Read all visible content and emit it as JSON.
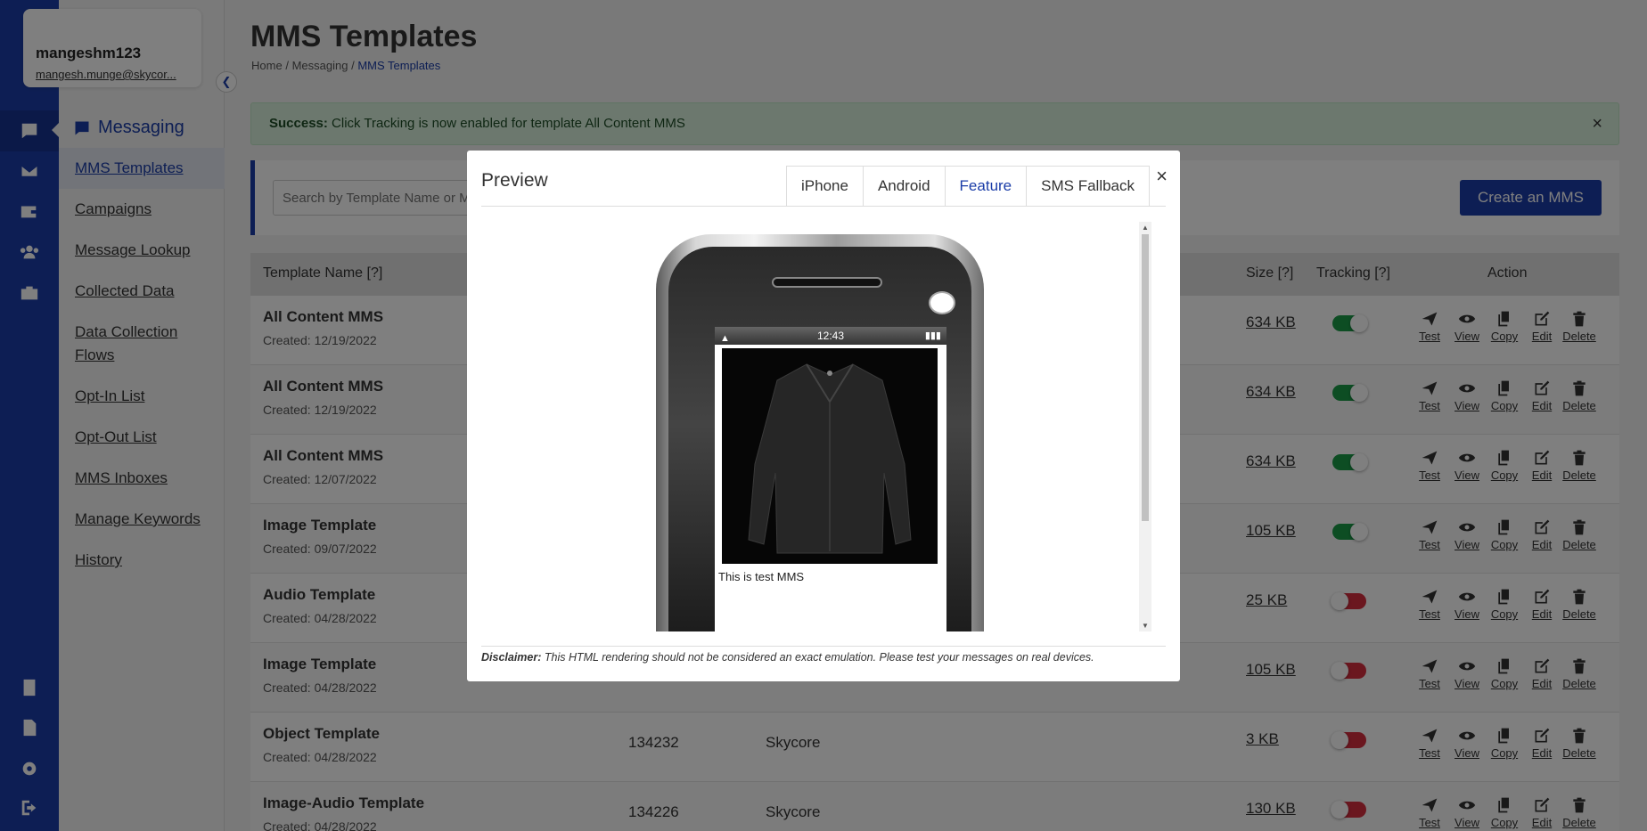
{
  "user": {
    "name": "mangeshm123",
    "email": "mangesh.munge@skycor..."
  },
  "sidebar": {
    "section": "Messaging",
    "items": [
      {
        "label": "MMS Templates"
      },
      {
        "label": "Campaigns"
      },
      {
        "label": "Message Lookup"
      },
      {
        "label": "Collected Data"
      },
      {
        "label": "Data Collection Flows"
      },
      {
        "label": "Opt-In List"
      },
      {
        "label": "Opt-Out List"
      },
      {
        "label": "MMS Inboxes"
      },
      {
        "label": "Manage Keywords"
      },
      {
        "label": "History"
      }
    ]
  },
  "page": {
    "title": "MMS Templates",
    "breadcrumb": {
      "home": "Home",
      "sep1": "/",
      "messaging": "Messaging",
      "sep2": "/",
      "current": "MMS Templates"
    }
  },
  "alert": {
    "strong": "Success:",
    "text": " Click Tracking is now enabled for template All Content MMS",
    "close": "×"
  },
  "toolbar": {
    "search_placeholder": "Search by Template Name or MMS ID",
    "create_label": "Create an MMS"
  },
  "table": {
    "headers": {
      "name": "Template Name [?]",
      "size": "Size [?]",
      "tracking": "Tracking [?]",
      "action": "Action"
    },
    "action_labels": {
      "test": "Test",
      "view": "View",
      "copy": "Copy",
      "edit": "Edit",
      "delete": "Delete"
    },
    "rows": [
      {
        "name": "All Content MMS",
        "created": "Created: 12/19/2022",
        "id": "",
        "account": "",
        "size": "634 KB",
        "tracking": true
      },
      {
        "name": "All Content MMS",
        "created": "Created: 12/19/2022",
        "id": "",
        "account": "",
        "size": "634 KB",
        "tracking": true
      },
      {
        "name": "All Content MMS",
        "created": "Created: 12/07/2022",
        "id": "",
        "account": "",
        "size": "634 KB",
        "tracking": true
      },
      {
        "name": "Image Template",
        "created": "Created: 09/07/2022",
        "id": "",
        "account": "",
        "size": "105 KB",
        "tracking": true
      },
      {
        "name": "Audio Template",
        "created": "Created: 04/28/2022",
        "id": "",
        "account": "",
        "size": "25 KB",
        "tracking": false
      },
      {
        "name": "Image Template",
        "created": "Created: 04/28/2022",
        "id": "",
        "account": "",
        "size": "105 KB",
        "tracking": false
      },
      {
        "name": "Object Template",
        "created": "Created: 04/28/2022",
        "id": "134232",
        "account": "Skycore",
        "size": "3 KB",
        "tracking": false
      },
      {
        "name": "Image-Audio Template",
        "created": "Created: 04/28/2022",
        "id": "134226",
        "account": "Skycore",
        "size": "130 KB",
        "tracking": false
      }
    ]
  },
  "modal": {
    "title": "Preview",
    "close": "×",
    "tabs": [
      {
        "label": "iPhone"
      },
      {
        "label": "Android"
      },
      {
        "label": "Feature"
      },
      {
        "label": "SMS Fallback"
      }
    ],
    "active_tab": "Feature",
    "phone": {
      "time": "12:43",
      "message_text": "This is test MMS"
    },
    "disclaimer_label": "Disclaimer:",
    "disclaimer_text": " This HTML rendering should not be considered an exact emulation. Please test your messages on real devices."
  },
  "colors": {
    "brand": "#1b3da8",
    "success_bg": "#d8f1dc",
    "toggle_on": "#1a9b47",
    "toggle_off": "#d62e3f"
  }
}
